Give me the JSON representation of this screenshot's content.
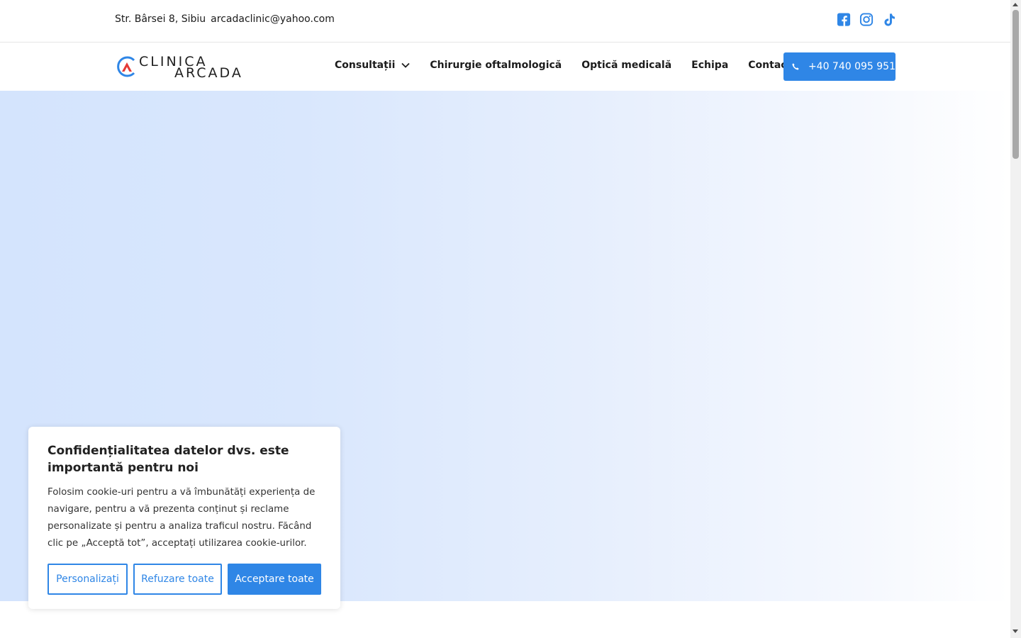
{
  "topbar": {
    "address": "Str. Bârsei 8, Sibiu",
    "email": "arcadaclinic@yahoo.com",
    "social": [
      "facebook-icon",
      "instagram-icon",
      "tiktok-icon"
    ]
  },
  "logo": {
    "line1": "CLINICA",
    "line2": "ARCADA"
  },
  "nav": {
    "items": [
      {
        "label": "Consultații"
      },
      {
        "label": "Chirurgie oftalmologică"
      },
      {
        "label": "Optică medicală"
      },
      {
        "label": "Echipa"
      },
      {
        "label": "Contact"
      }
    ],
    "phone_label": "+40 740 095 951"
  },
  "cookie": {
    "title": "Confidențialitatea datelor dvs. este importantă pentru noi",
    "text": "Folosim cookie-uri pentru a vă îmbunătăți experiența de navigare, pentru a vă prezenta conținut și reclame personalizate și pentru a analiza traficul nostru. Făcând clic pe „Acceptă tot”, acceptați utilizarea cookie-urilor.",
    "customize_label": "Personalizați",
    "reject_label": "Refuzare toate",
    "accept_label": "Acceptare toate"
  },
  "colors": {
    "accent": "#2f86e6",
    "logo_red": "#e53935",
    "hero_start": "#d4e4fd",
    "hero_end": "#ffffff"
  }
}
